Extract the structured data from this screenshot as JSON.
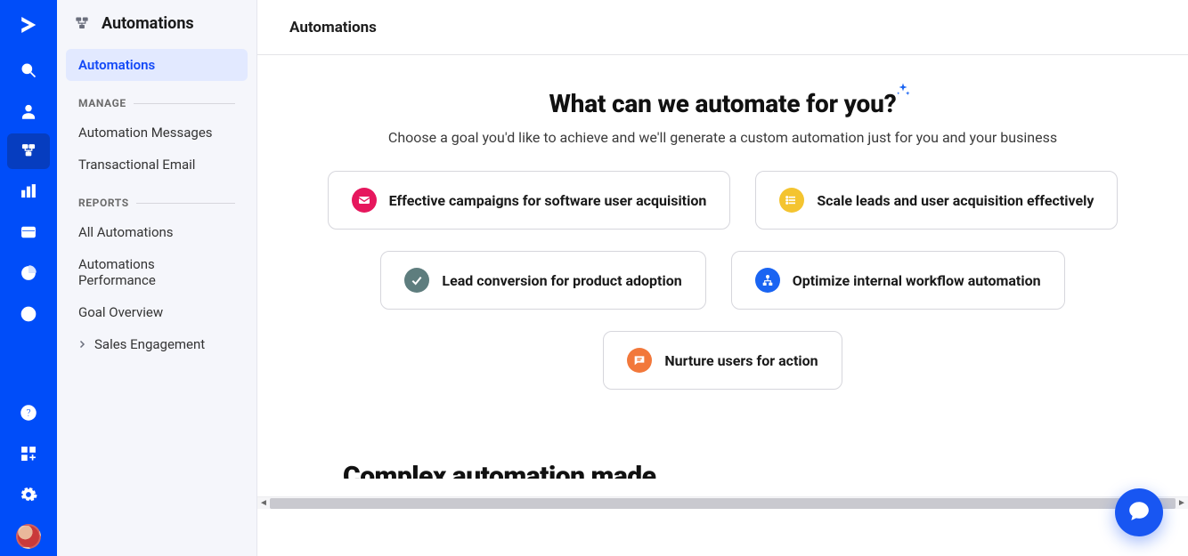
{
  "rail": {
    "logo_name": "activecampaign-logo-icon",
    "items": [
      {
        "name": "search-icon"
      },
      {
        "name": "contacts-icon"
      },
      {
        "name": "automations-icon",
        "active": true
      },
      {
        "name": "campaigns-icon"
      },
      {
        "name": "deals-icon"
      },
      {
        "name": "reports-icon"
      },
      {
        "name": "website-icon"
      }
    ],
    "bottom": [
      {
        "name": "help-icon"
      },
      {
        "name": "apps-icon"
      },
      {
        "name": "settings-icon"
      },
      {
        "name": "avatar"
      }
    ]
  },
  "sidebar": {
    "header_title": "Automations",
    "items": [
      {
        "label": "Automations",
        "active": true
      }
    ],
    "sections": [
      {
        "label": "MANAGE",
        "items": [
          {
            "label": "Automation Messages"
          },
          {
            "label": "Transactional Email"
          }
        ]
      },
      {
        "label": "REPORTS",
        "items": [
          {
            "label": "All Automations"
          },
          {
            "label": "Automations Performance"
          },
          {
            "label": "Goal Overview"
          },
          {
            "label": "Sales Engagement",
            "has_children": true
          }
        ]
      }
    ]
  },
  "topbar": {
    "title": "Automations"
  },
  "hero": {
    "title": "What can we automate for you?",
    "subtitle": "Choose a goal you'd like to achieve and we'll generate a custom automation just for you and your business"
  },
  "cards": [
    {
      "label": "Effective campaigns for software user acquisition",
      "icon": "mail-icon",
      "color": "pink"
    },
    {
      "label": "Scale leads and user acquisition effectively",
      "icon": "list-icon",
      "color": "yellow"
    },
    {
      "label": "Lead conversion for product adoption",
      "icon": "check-icon",
      "color": "teal"
    },
    {
      "label": "Optimize internal workflow automation",
      "icon": "workflow-icon",
      "color": "blue"
    },
    {
      "label": "Nurture users for action",
      "icon": "chat-icon",
      "color": "orange"
    }
  ],
  "cutoff_heading": "Complex automation made",
  "chat_fab_name": "chat-launcher"
}
